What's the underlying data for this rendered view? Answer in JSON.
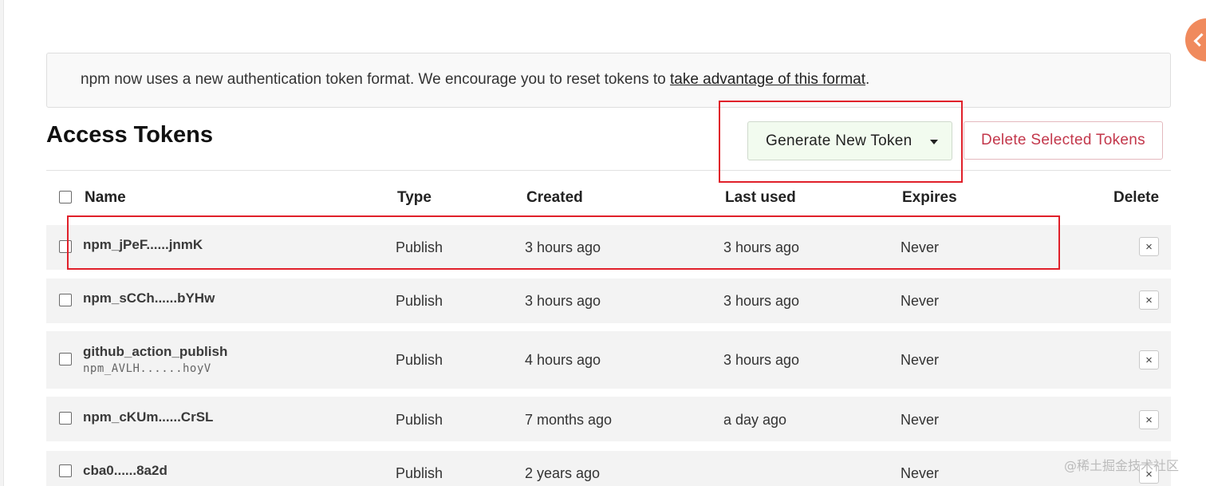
{
  "banner": {
    "text": "npm now uses a new authentication token format. We encourage you to reset tokens to ",
    "link": "take advantage of this format",
    "suffix": "."
  },
  "page_title": "Access Tokens",
  "actions": {
    "generate": "Generate New Token",
    "delete_selected": "Delete Selected Tokens"
  },
  "table": {
    "headers": {
      "name": "Name",
      "type": "Type",
      "created": "Created",
      "last_used": "Last used",
      "expires": "Expires",
      "delete": "Delete"
    },
    "rows": [
      {
        "name": "npm_jPeF......jnmK",
        "sub": "",
        "type": "Publish",
        "created": "3 hours ago",
        "last_used": "3 hours ago",
        "expires": "Never"
      },
      {
        "name": "npm_sCCh......bYHw",
        "sub": "",
        "type": "Publish",
        "created": "3 hours ago",
        "last_used": "3 hours ago",
        "expires": "Never"
      },
      {
        "name": "github_action_publish",
        "sub": "npm_AVLH......hoyV",
        "type": "Publish",
        "created": "4 hours ago",
        "last_used": "3 hours ago",
        "expires": "Never"
      },
      {
        "name": "npm_cKUm......CrSL",
        "sub": "",
        "type": "Publish",
        "created": "7 months ago",
        "last_used": "a day ago",
        "expires": "Never"
      },
      {
        "name": "cba0......8a2d",
        "sub": "",
        "type": "Publish",
        "created": "2 years ago",
        "last_used": "",
        "expires": "Never"
      }
    ]
  },
  "delete_glyph": "×",
  "watermark": "@稀土掘金技术社区",
  "colors": {
    "annotation": "#e0202a",
    "danger": "#c3374b",
    "generate_bg": "#f2fbef"
  }
}
